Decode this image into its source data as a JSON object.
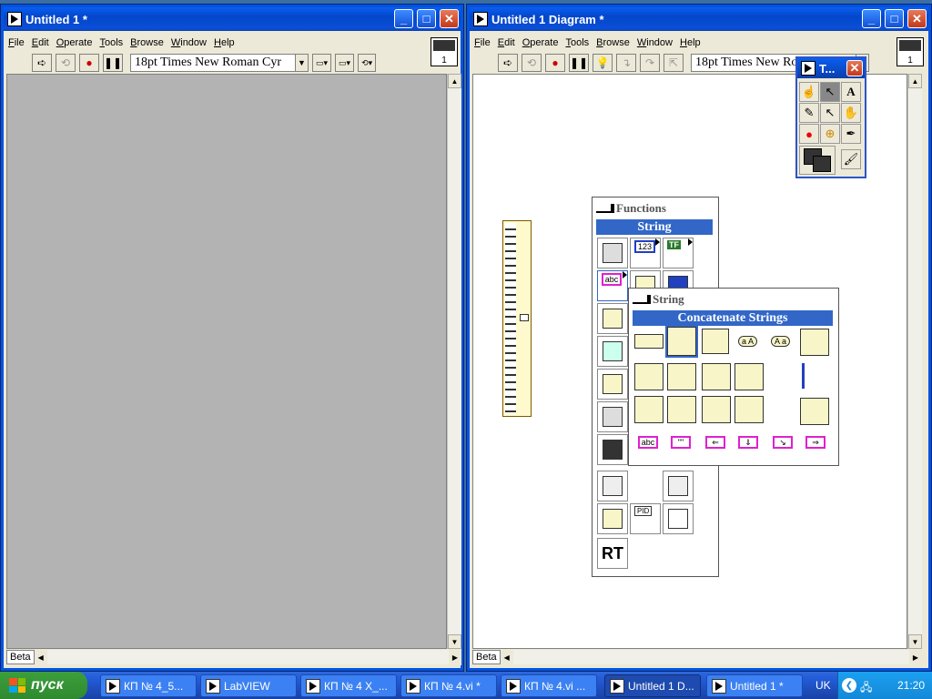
{
  "left_window": {
    "title": "Untitled 1 *",
    "menu": [
      "File",
      "Edit",
      "Operate",
      "Tools",
      "Browse",
      "Window",
      "Help"
    ],
    "font": "18pt Times New Roman Cyr",
    "status": "Beta",
    "vi_icon_label": "1"
  },
  "right_window": {
    "title": "Untitled 1 Diagram *",
    "menu": [
      "File",
      "Edit",
      "Operate",
      "Tools",
      "Browse",
      "Window",
      "Help"
    ],
    "font": "18pt Times New Roman Cyr",
    "status": "Beta",
    "vi_icon_label": "1"
  },
  "tools_palette": {
    "title": "T...",
    "tools": [
      "operate-value",
      "position-select",
      "edit-text",
      "connect-wire",
      "object-shortcut-menu",
      "scroll-window",
      "set-clear-breakpoint",
      "probe-data",
      "get-color",
      "set-color"
    ]
  },
  "functions_palette": {
    "header": "Functions",
    "category": "String",
    "rt_label": "RT",
    "icon_texts": {
      "numeric": "123",
      "boolean": "TF",
      "string": "abc",
      "pid": "PID"
    }
  },
  "string_palette": {
    "header": "String",
    "category": "Concatenate Strings",
    "icon_texts": {
      "to_upper": "a A",
      "to_lower": "A a",
      "string_constant": "abc",
      "empty_string": "\"\"",
      "format_date": "JAN 01 12:00"
    }
  },
  "taskbar": {
    "start_label": "пуск",
    "tasks": [
      "КП № 4_5...",
      "LabVIEW",
      "КП № 4 Х_...",
      "КП № 4.vi *",
      "КП № 4.vi ...",
      "Untitled 1 D...",
      "Untitled 1 *"
    ],
    "active_task": "Untitled 1 D...",
    "language": "UK",
    "time": "21:20"
  },
  "colors": {
    "titlebar": "#0a5ef0",
    "front_panel_bg": "#b3b3b3",
    "diagram_bg": "#ffffff",
    "palette_category": "#3267c8",
    "string_pink": "#e020d0"
  }
}
